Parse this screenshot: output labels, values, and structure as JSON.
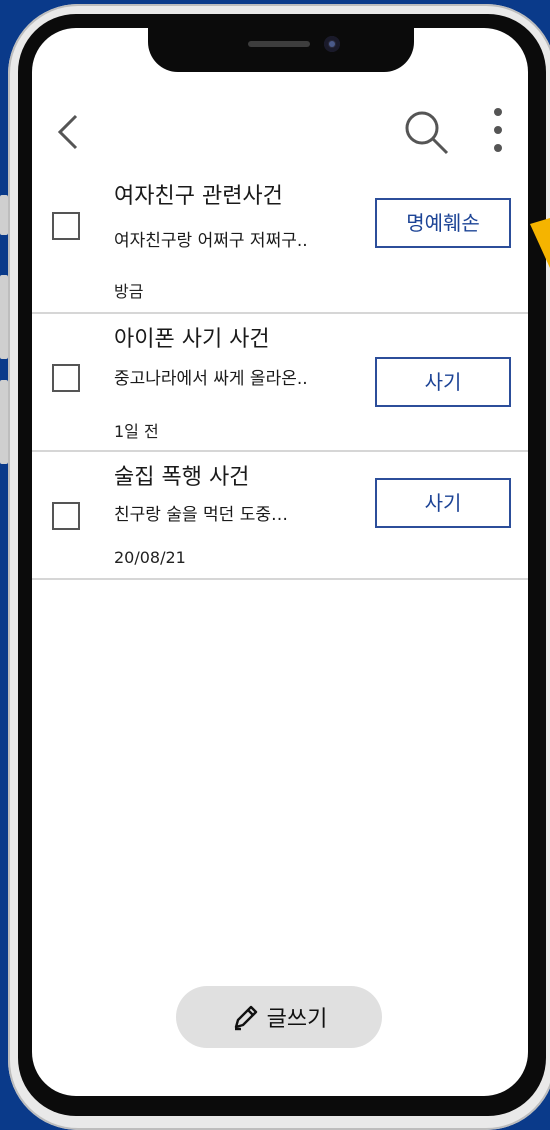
{
  "header": {
    "back_icon": "chevron-left-icon",
    "search_icon": "search-icon",
    "more_icon": "more-vertical-icon"
  },
  "posts": [
    {
      "title": "여자친구 관련사건",
      "preview": "여자친구랑 어쩌구 저쩌구..",
      "time": "방금",
      "tag": "명예훼손",
      "checked": false
    },
    {
      "title": "아이폰 사기 사건",
      "preview": "중고나라에서 싸게 올라온..",
      "time": "1일 전",
      "tag": "사기",
      "checked": false
    },
    {
      "title": "술집 폭행 사건",
      "preview": "친구랑 술을 먹던 도중…",
      "time": "20/08/21",
      "tag": "사기",
      "checked": false
    }
  ],
  "write_button": {
    "label": "글쓰기",
    "icon": "pencil-icon"
  },
  "colors": {
    "background": "#0a3a8a",
    "tag_border": "#2c4e9a",
    "tag_text": "#1d4496",
    "pointer": "#f5b400"
  }
}
